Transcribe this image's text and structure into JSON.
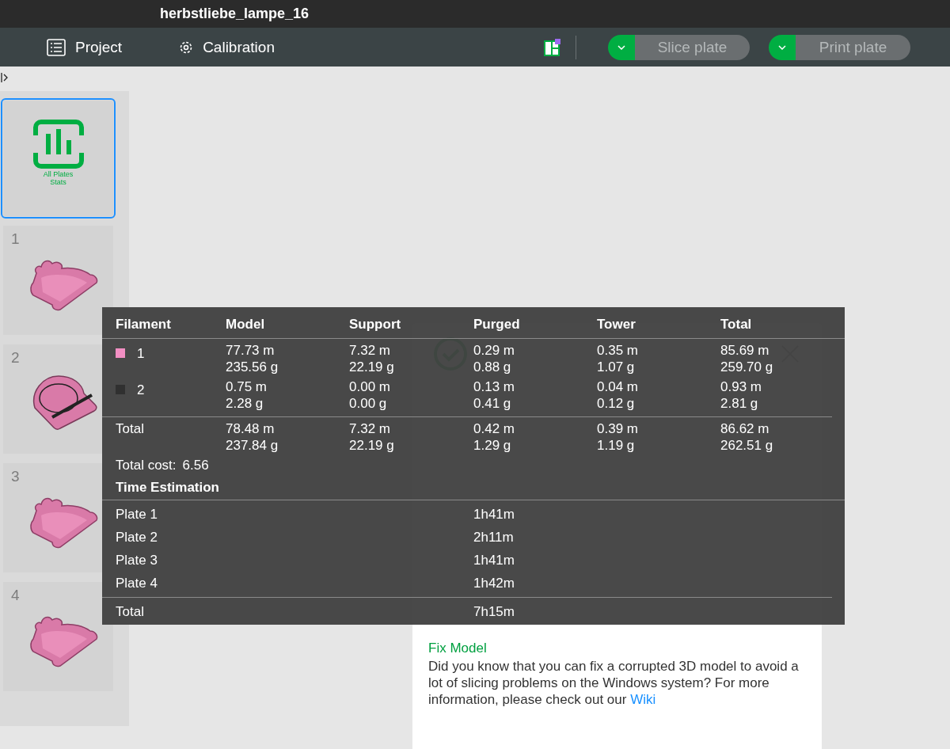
{
  "window": {
    "title": "herbstliebe_lampe_16"
  },
  "toolbar": {
    "tabs": [
      {
        "label": "Project",
        "kind": "list"
      },
      {
        "label": "Calibration",
        "kind": "gear"
      }
    ],
    "actions": [
      {
        "label": "Slice plate",
        "disabled": true
      },
      {
        "label": "Print plate",
        "disabled": true
      }
    ]
  },
  "sidebar": {
    "summary": {
      "lines": [
        "All Plates",
        "Stats"
      ],
      "selected": true
    },
    "plates": [
      {
        "number": "1",
        "kind": "frame",
        "selected": false
      },
      {
        "number": "2",
        "kind": "pumpkin",
        "selected": false
      },
      {
        "number": "3",
        "kind": "frame",
        "selected": false
      },
      {
        "number": "4",
        "kind": "frame",
        "selected": false
      }
    ]
  },
  "tips": {
    "title": "Fix Model",
    "body": "Did you know that you can fix a corrupted 3D model to avoid a lot of slicing problems on the Windows system? For more information, please check out our",
    "link": "Wiki"
  },
  "stats": {
    "headers": [
      "Filament",
      "Model",
      "Support",
      "Purged",
      "Tower",
      "Total"
    ],
    "filaments": [
      {
        "index": "1",
        "color": "#f28fc3",
        "cells": [
          [
            "77.73 m",
            "235.56 g"
          ],
          [
            "7.32 m",
            "22.19 g"
          ],
          [
            "0.29 m",
            "0.88 g"
          ],
          [
            "0.35 m",
            "1.07 g"
          ],
          [
            "85.69 m",
            "259.70 g"
          ]
        ]
      },
      {
        "index": "2",
        "color": "#303030",
        "cells": [
          [
            "0.75 m",
            "2.28 g"
          ],
          [
            "0.00 m",
            "0.00 g"
          ],
          [
            "0.13 m",
            "0.41 g"
          ],
          [
            "0.04 m",
            "0.12 g"
          ],
          [
            "0.93 m",
            "2.81 g"
          ]
        ]
      }
    ],
    "total": {
      "label": "Total",
      "cells": [
        [
          "78.48 m",
          "237.84 g"
        ],
        [
          "7.32 m",
          "22.19 g"
        ],
        [
          "0.42 m",
          "1.29 g"
        ],
        [
          "0.39 m",
          "1.19 g"
        ],
        [
          "86.62 m",
          "262.51 g"
        ]
      ]
    },
    "cost": {
      "label": "Total cost:",
      "value": "6.56"
    },
    "time": {
      "title": "Time Estimation",
      "plates": [
        {
          "label": "Plate 1",
          "time": "1h41m"
        },
        {
          "label": "Plate 2",
          "time": "2h11m"
        },
        {
          "label": "Plate 3",
          "time": "1h41m"
        },
        {
          "label": "Plate 4",
          "time": "1h42m"
        }
      ],
      "total": {
        "label": "Total",
        "time": "7h15m"
      }
    }
  }
}
